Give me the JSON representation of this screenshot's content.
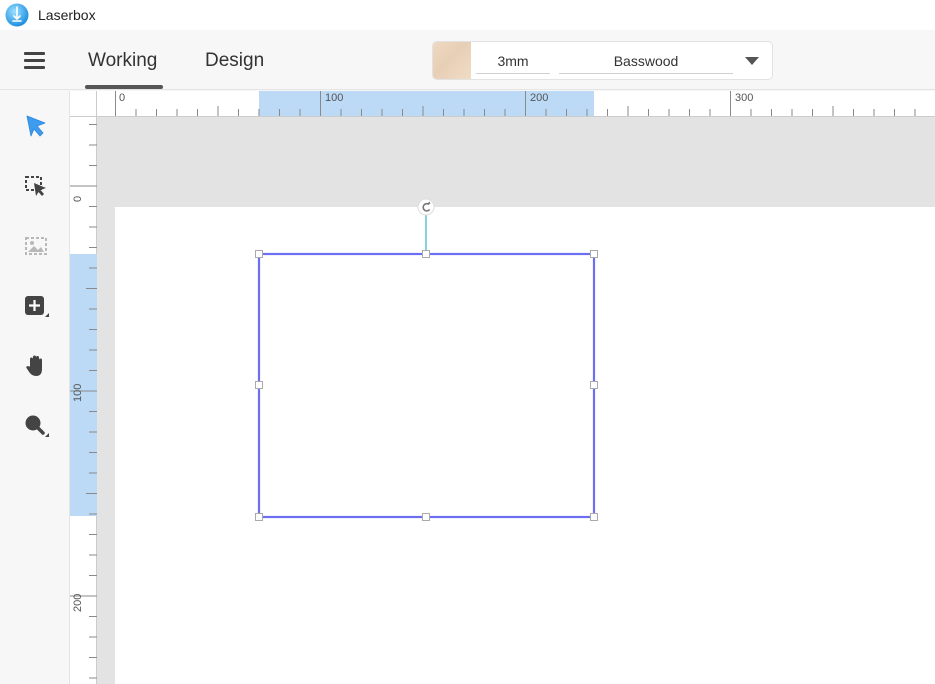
{
  "window": {
    "title": "Laserbox"
  },
  "header": {
    "tabs": [
      {
        "label": "Working"
      },
      {
        "label": "Design"
      }
    ],
    "material": {
      "thickness": "3mm",
      "name": "Basswood",
      "swatch_color": "#eed6bf"
    }
  },
  "toolbar": {
    "tools": [
      {
        "icon": "select-arrow-icon"
      },
      {
        "icon": "marquee-select-icon"
      },
      {
        "icon": "image-placeholder-icon"
      },
      {
        "icon": "add-shape-icon"
      },
      {
        "icon": "hand-pan-icon"
      },
      {
        "icon": "zoom-icon"
      }
    ]
  },
  "rulers": {
    "top_labels": [
      "0",
      "100",
      "200",
      "300"
    ],
    "left_labels": [
      "0",
      "100",
      "200"
    ]
  },
  "colors": {
    "accent": "#3d9cf0",
    "selection_stroke": "#6b6ff0",
    "ruler_highlight": "#bcd9f6"
  }
}
